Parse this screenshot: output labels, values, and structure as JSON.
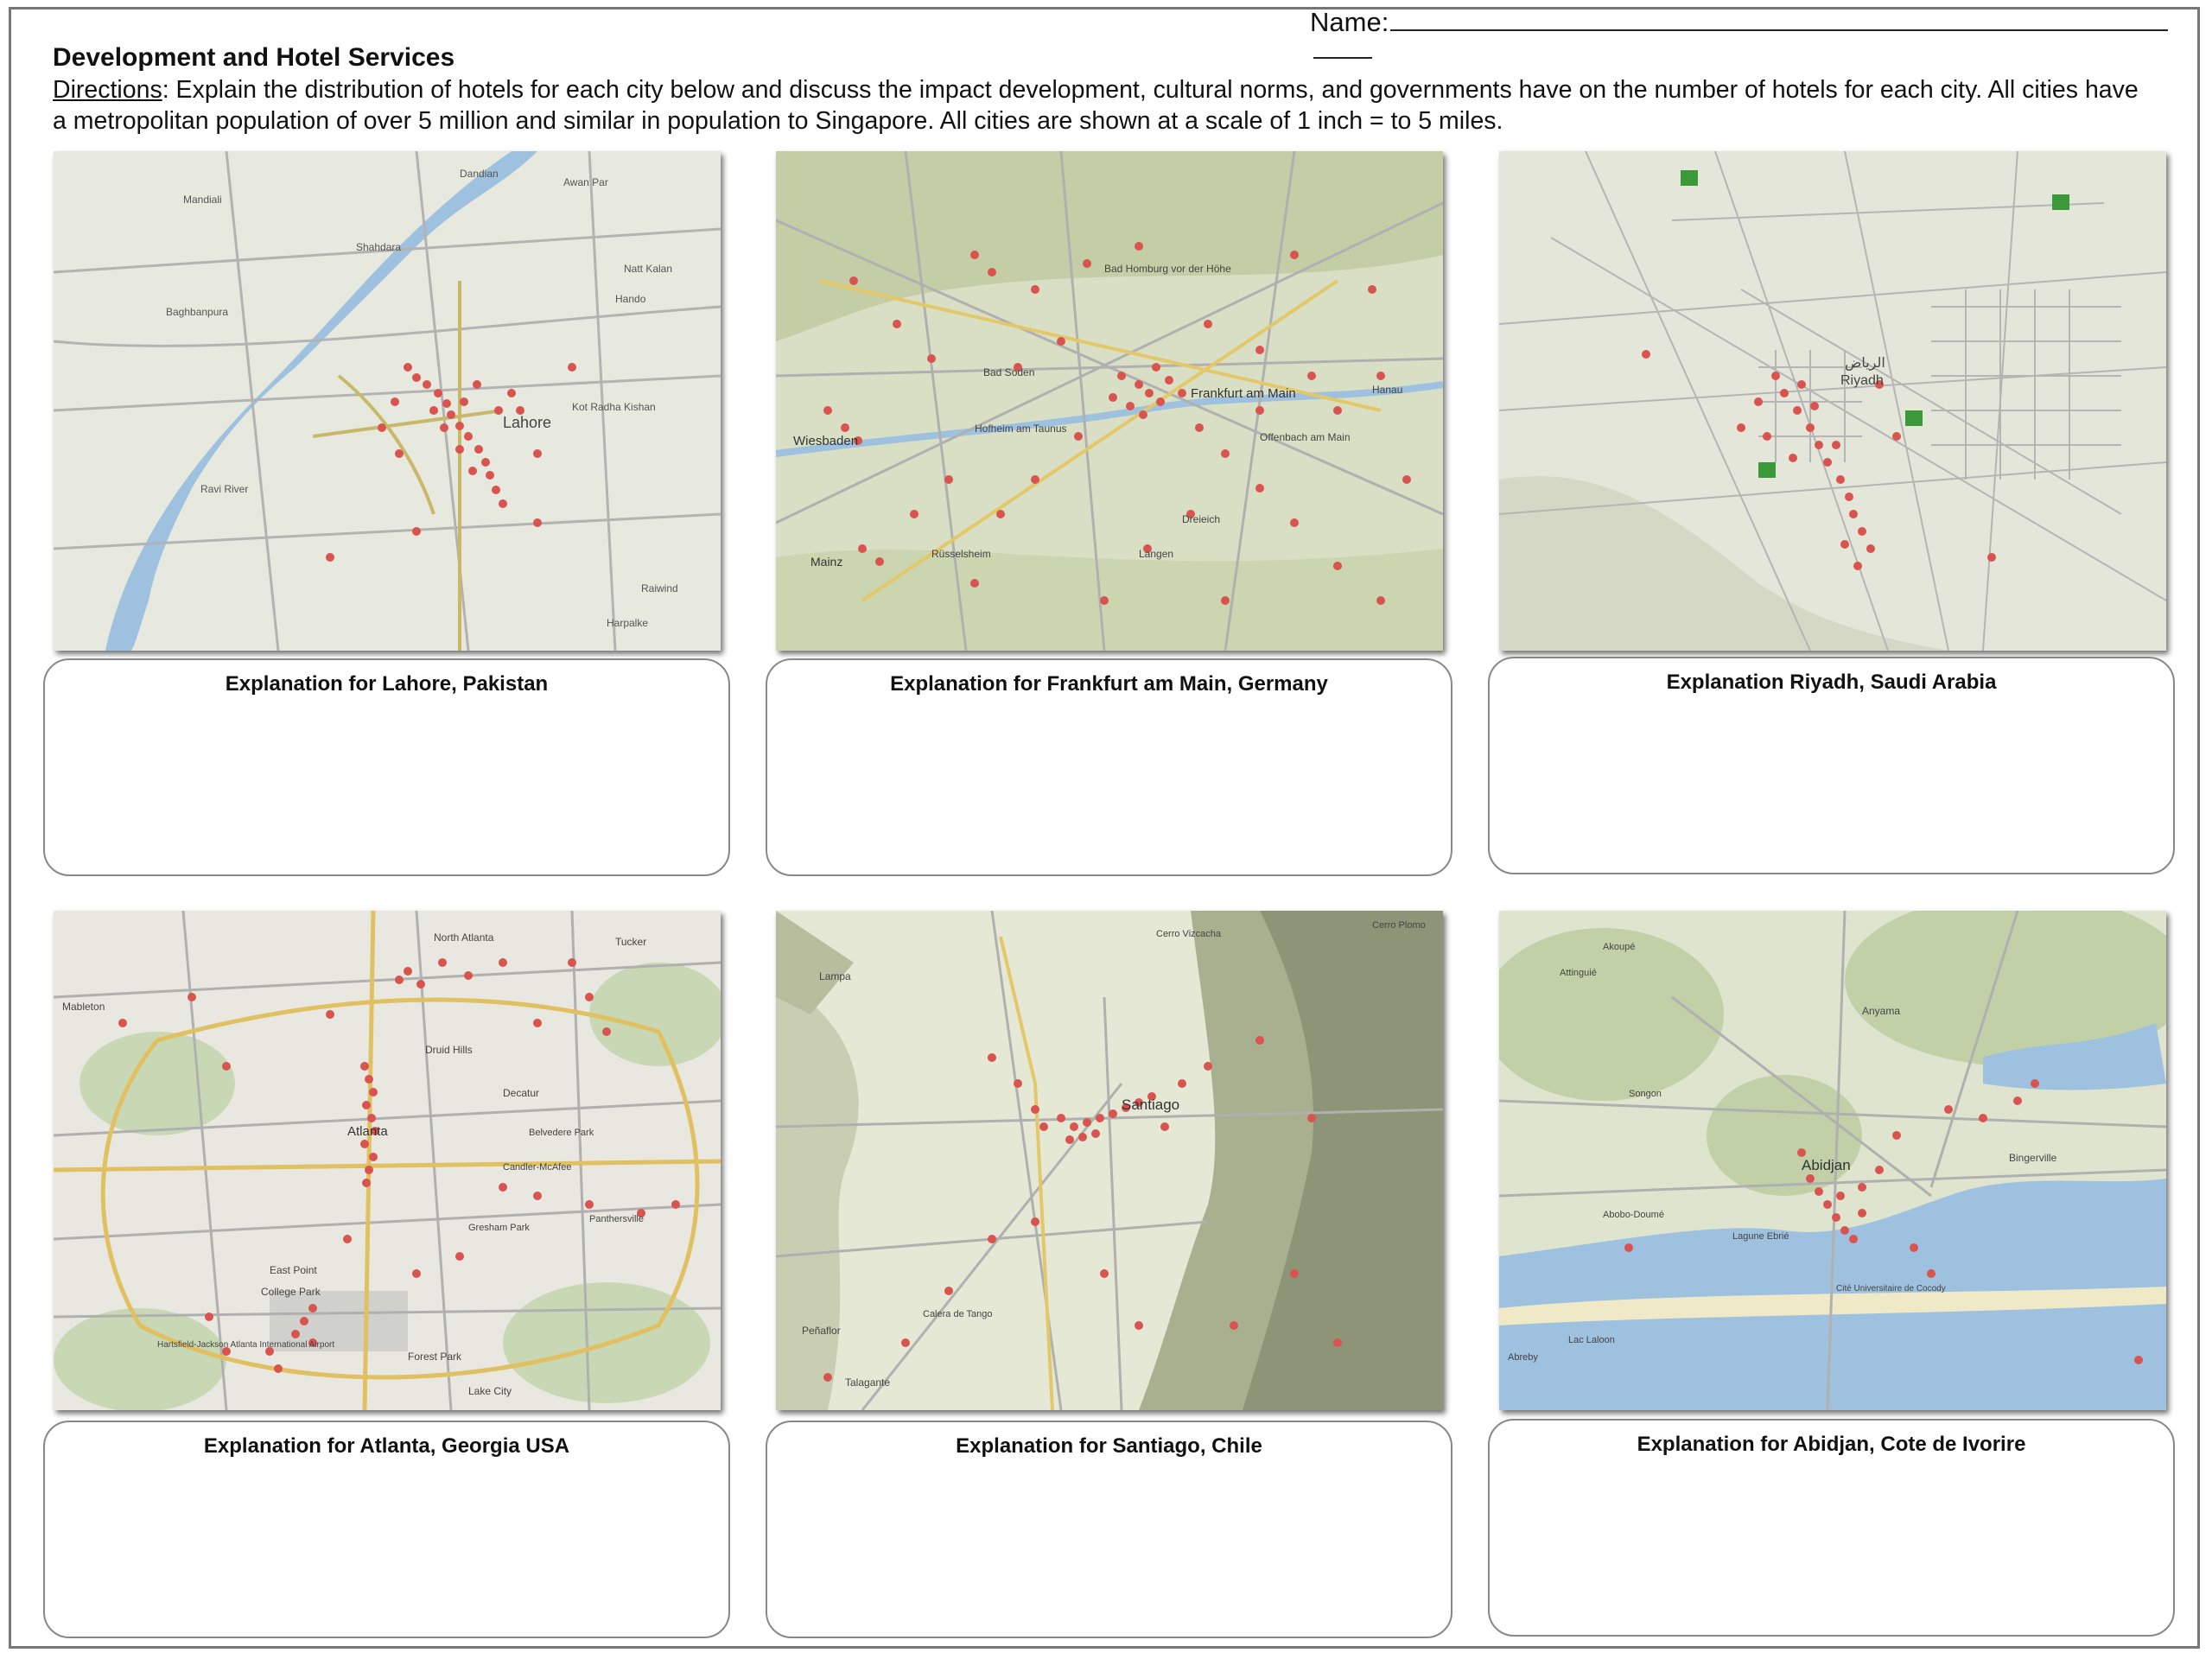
{
  "header": {
    "name_label": "Name:",
    "title": "Development and Hotel Services",
    "directions_label": "Directions",
    "directions_text": ": Explain the distribution of hotels for each city below and discuss the impact development, cultural norms, and governments have on the number of hotels for each city. All cities have a metropolitan population of over 5 million and similar in population to Singapore. All cities are shown at a scale of 1 inch = to 5 miles."
  },
  "cities": [
    {
      "caption": "Explanation for Lahore, Pakistan",
      "map_labels": [
        "Lahore",
        "Shahdara",
        "Mandiali",
        "Baghbanpura",
        "Kot Radha Kishan",
        "Ravi River",
        "Harpalke",
        "Raiwind",
        "Dandian",
        "Awan Par",
        "Natt Kalan",
        "Hando"
      ]
    },
    {
      "caption": "Explanation for Frankfurt am Main, Germany",
      "map_labels": [
        "Frankfurt am Main",
        "Wiesbaden",
        "Mainz",
        "Bad Homburg vor der Höhe",
        "Offenbach am Main",
        "Hanau",
        "Rüsselsheim",
        "Bad Soden",
        "Hofheim am Taunus",
        "Langen",
        "Dreieich"
      ]
    },
    {
      "caption": "Explanation Riyadh, Saudi Arabia",
      "map_labels": [
        "Riyadh",
        "الرياض"
      ]
    },
    {
      "caption": "Explanation for Atlanta, Georgia USA",
      "map_labels": [
        "Atlanta",
        "Decatur",
        "North Atlanta",
        "Druid Hills",
        "East Point",
        "College Park",
        "Hartsfield-Jackson Atlanta International Airport",
        "Forest Park",
        "Lake City",
        "Mableton",
        "Tucker",
        "Belvedere Park",
        "Candler-McAfee",
        "Gresham Park",
        "Panthersville"
      ]
    },
    {
      "caption": "Explanation for Santiago, Chile",
      "map_labels": [
        "Santiago",
        "Lampa",
        "Peñaflor",
        "Talagante",
        "Calera de Tango",
        "Cerro Vizcacha",
        "Cerro Plomo"
      ]
    },
    {
      "caption": "Explanation for Abidjan, Cote de Ivorire",
      "map_labels": [
        "Abidjan",
        "Anyama",
        "Bingerville",
        "Cité Universitaire de Cocody",
        "Abobo-Doumé",
        "Lagune Ebrié",
        "Akoupé",
        "Attinguié",
        "Songon",
        "Lac Laloon",
        "Abreby"
      ]
    }
  ],
  "colors": {
    "hotel_marker": "#d9534f",
    "map_land": "#e8ebdf",
    "map_water": "#9ec1df",
    "map_road": "#a9a9a9"
  }
}
